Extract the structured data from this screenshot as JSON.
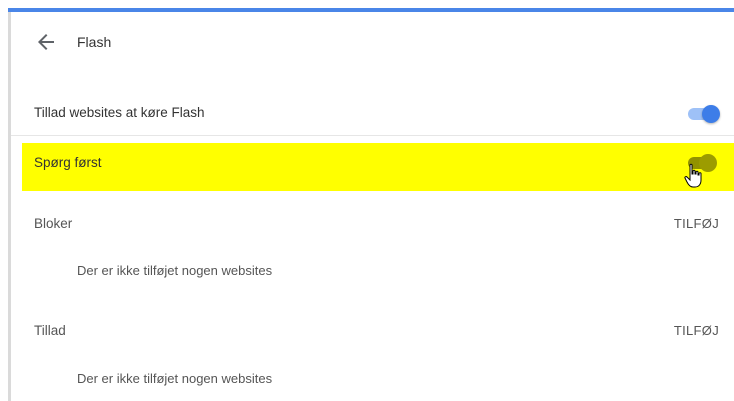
{
  "header": {
    "title": "Flash",
    "back_icon": "arrow-left-icon"
  },
  "settings": {
    "allow_flash": {
      "label": "Tillad websites at køre Flash",
      "state": "on"
    },
    "ask_first": {
      "label": "Spørg først",
      "state": "on",
      "highlight_color": "#ffff00"
    }
  },
  "sections": {
    "block": {
      "title": "Bloker",
      "add_label": "TILFØJ",
      "empty_text": "Der er ikke tilføjet nogen websites"
    },
    "allow": {
      "title": "Tillad",
      "add_label": "TILFØJ",
      "empty_text": "Der er ikke tilføjet nogen websites"
    }
  },
  "colors": {
    "accent": "#4a86e8",
    "toggle_on": "#3d7de8"
  }
}
